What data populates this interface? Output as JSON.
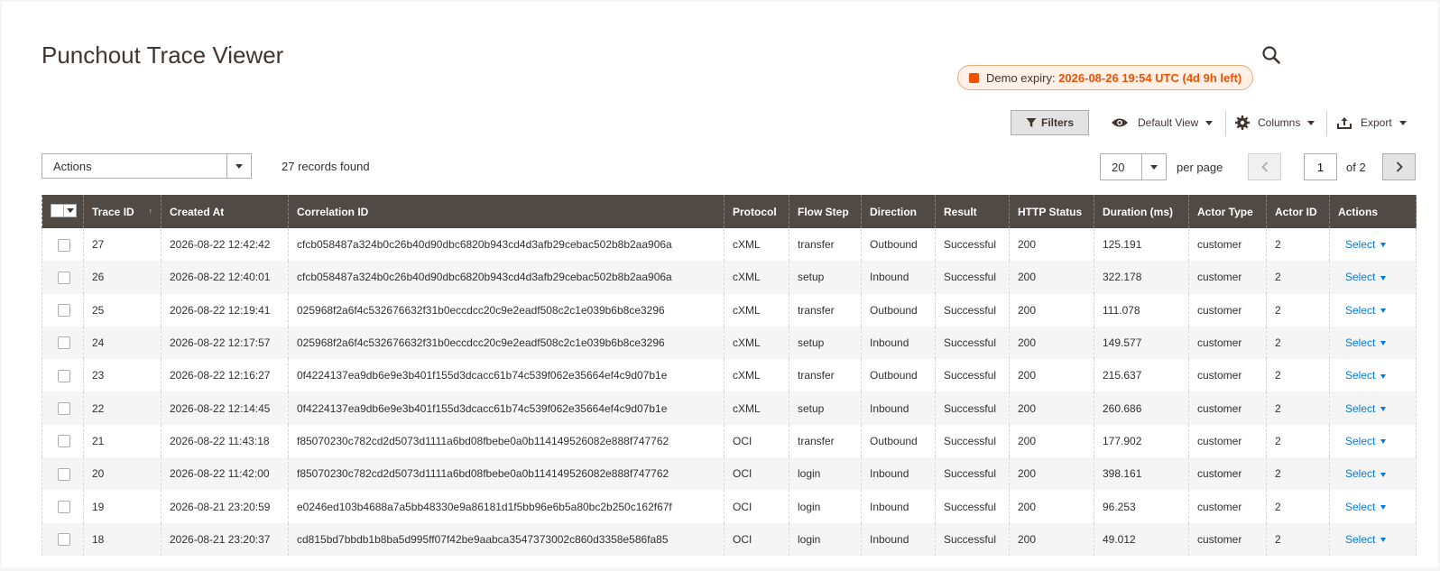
{
  "page": {
    "title": "Punchout Trace Viewer"
  },
  "demo": {
    "prefix": "Demo expiry:",
    "value": "2026-08-26 19:54 UTC (4d 9h left)"
  },
  "toolbar": {
    "filters_label": "Filters",
    "view_label": "Default View",
    "columns_label": "Columns",
    "export_label": "Export"
  },
  "mass_actions": {
    "label": "Actions"
  },
  "records": {
    "text": "27 records found"
  },
  "pager": {
    "per_page_value": "20",
    "per_page_label": "per page",
    "current_page": "1",
    "of_label": "of 2"
  },
  "columns": [
    "Trace ID",
    "Created At",
    "Correlation ID",
    "Protocol",
    "Flow Step",
    "Direction",
    "Result",
    "HTTP Status",
    "Duration (ms)",
    "Actor Type",
    "Actor ID",
    "Actions"
  ],
  "row_action_label": "Select",
  "rows": [
    {
      "id": "27",
      "created": "2026-08-22 12:42:42",
      "corr": "cfcb058487a324b0c26b40d90dbc6820b943cd4d3afb29cebac502b8b2aa906a",
      "protocol": "cXML",
      "step": "transfer",
      "direction": "Outbound",
      "result": "Successful",
      "http": "200",
      "duration": "125.191",
      "actor_type": "customer",
      "actor_id": "2"
    },
    {
      "id": "26",
      "created": "2026-08-22 12:40:01",
      "corr": "cfcb058487a324b0c26b40d90dbc6820b943cd4d3afb29cebac502b8b2aa906a",
      "protocol": "cXML",
      "step": "setup",
      "direction": "Inbound",
      "result": "Successful",
      "http": "200",
      "duration": "322.178",
      "actor_type": "customer",
      "actor_id": "2"
    },
    {
      "id": "25",
      "created": "2026-08-22 12:19:41",
      "corr": "025968f2a6f4c532676632f31b0eccdcc20c9e2eadf508c2c1e039b6b8ce3296",
      "protocol": "cXML",
      "step": "transfer",
      "direction": "Outbound",
      "result": "Successful",
      "http": "200",
      "duration": "111.078",
      "actor_type": "customer",
      "actor_id": "2"
    },
    {
      "id": "24",
      "created": "2026-08-22 12:17:57",
      "corr": "025968f2a6f4c532676632f31b0eccdcc20c9e2eadf508c2c1e039b6b8ce3296",
      "protocol": "cXML",
      "step": "setup",
      "direction": "Inbound",
      "result": "Successful",
      "http": "200",
      "duration": "149.577",
      "actor_type": "customer",
      "actor_id": "2"
    },
    {
      "id": "23",
      "created": "2026-08-22 12:16:27",
      "corr": "0f4224137ea9db6e9e3b401f155d3dcacc61b74c539f062e35664ef4c9d07b1e",
      "protocol": "cXML",
      "step": "transfer",
      "direction": "Outbound",
      "result": "Successful",
      "http": "200",
      "duration": "215.637",
      "actor_type": "customer",
      "actor_id": "2"
    },
    {
      "id": "22",
      "created": "2026-08-22 12:14:45",
      "corr": "0f4224137ea9db6e9e3b401f155d3dcacc61b74c539f062e35664ef4c9d07b1e",
      "protocol": "cXML",
      "step": "setup",
      "direction": "Inbound",
      "result": "Successful",
      "http": "200",
      "duration": "260.686",
      "actor_type": "customer",
      "actor_id": "2"
    },
    {
      "id": "21",
      "created": "2026-08-22 11:43:18",
      "corr": "f85070230c782cd2d5073d1111a6bd08fbebe0a0b114149526082e888f747762",
      "protocol": "OCI",
      "step": "transfer",
      "direction": "Outbound",
      "result": "Successful",
      "http": "200",
      "duration": "177.902",
      "actor_type": "customer",
      "actor_id": "2"
    },
    {
      "id": "20",
      "created": "2026-08-22 11:42:00",
      "corr": "f85070230c782cd2d5073d1111a6bd08fbebe0a0b114149526082e888f747762",
      "protocol": "OCI",
      "step": "login",
      "direction": "Inbound",
      "result": "Successful",
      "http": "200",
      "duration": "398.161",
      "actor_type": "customer",
      "actor_id": "2"
    },
    {
      "id": "19",
      "created": "2026-08-21 23:20:59",
      "corr": "e0246ed103b4688a7a5bb48330e9a86181d1f5bb96e6b5a80bc2b250c162f67f",
      "protocol": "OCI",
      "step": "login",
      "direction": "Inbound",
      "result": "Successful",
      "http": "200",
      "duration": "96.253",
      "actor_type": "customer",
      "actor_id": "2"
    },
    {
      "id": "18",
      "created": "2026-08-21 23:20:37",
      "corr": "cd815bd7bbdb1b8ba5d995ff07f42be9aabca3547373002c860d3358e586fa85",
      "protocol": "OCI",
      "step": "login",
      "direction": "Inbound",
      "result": "Successful",
      "http": "200",
      "duration": "49.012",
      "actor_type": "customer",
      "actor_id": "2"
    }
  ],
  "colors": {
    "header_bg": "#514943",
    "accent": "#eb5202",
    "link": "#007bdb"
  }
}
